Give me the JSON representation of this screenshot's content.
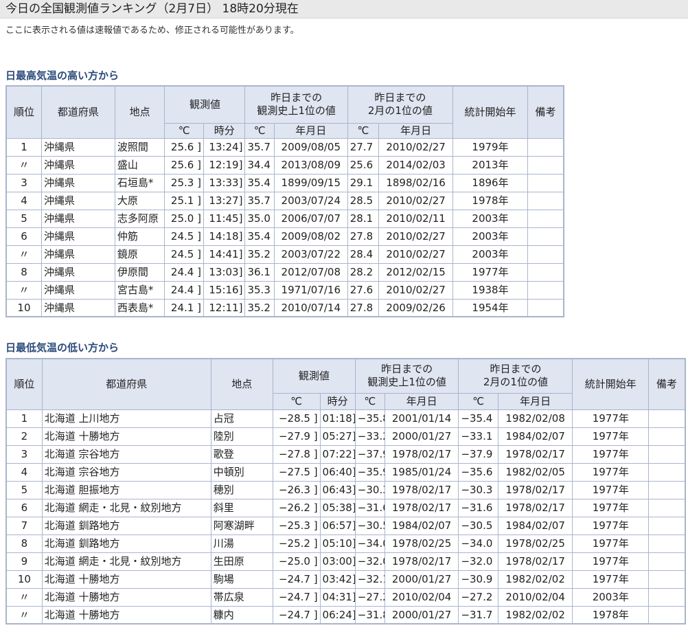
{
  "page": {
    "title": "今日の全国観測値ランキング（2月7日） 18時20分現在",
    "notice": "ここに表示される値は速報値であるため、修正される可能性があります。"
  },
  "headers": {
    "rank": "順位",
    "prefecture": "都道府県",
    "station": "地点",
    "observed": "観測値",
    "record_all": "昨日までの 観測史上1位の値",
    "record_month": "昨日までの 2月の1位の値",
    "start_year": "統計開始年",
    "remarks": "備考",
    "deg": "℃",
    "time": "時分",
    "date": "年月日"
  },
  "high": {
    "title": "日最高気温の高い方から",
    "rows": [
      {
        "rank": "1",
        "pref": "沖縄県",
        "station": "波照間",
        "val": "25.6 ]",
        "time": "13:24]",
        "rec_val": "35.7",
        "rec_date": "2009/08/05",
        "mon_val": "27.7",
        "mon_date": "2010/02/27",
        "start": "1979年",
        "note": ""
      },
      {
        "rank": "〃",
        "pref": "沖縄県",
        "station": "盛山",
        "val": "25.6 ]",
        "time": "12:19]",
        "rec_val": "34.4",
        "rec_date": "2013/08/09",
        "mon_val": "25.6",
        "mon_date": "2014/02/03",
        "start": "2013年",
        "note": ""
      },
      {
        "rank": "3",
        "pref": "沖縄県",
        "station": "石垣島*",
        "val": "25.3 ]",
        "time": "13:33]",
        "rec_val": "35.4",
        "rec_date": "1899/09/15",
        "mon_val": "29.1",
        "mon_date": "1898/02/16",
        "start": "1896年",
        "note": ""
      },
      {
        "rank": "4",
        "pref": "沖縄県",
        "station": "大原",
        "val": "25.1 ]",
        "time": "13:27]",
        "rec_val": "35.7",
        "rec_date": "2003/07/24",
        "mon_val": "28.5",
        "mon_date": "2010/02/27",
        "start": "1978年",
        "note": ""
      },
      {
        "rank": "5",
        "pref": "沖縄県",
        "station": "志多阿原",
        "val": "25.0 ]",
        "time": "11:45]",
        "rec_val": "35.0",
        "rec_date": "2006/07/07",
        "mon_val": "28.1",
        "mon_date": "2010/02/11",
        "start": "2003年",
        "note": ""
      },
      {
        "rank": "6",
        "pref": "沖縄県",
        "station": "仲筋",
        "val": "24.5 ]",
        "time": "14:18]",
        "rec_val": "35.4",
        "rec_date": "2009/08/02",
        "mon_val": "27.8",
        "mon_date": "2010/02/27",
        "start": "2003年",
        "note": ""
      },
      {
        "rank": "〃",
        "pref": "沖縄県",
        "station": "鏡原",
        "val": "24.5 ]",
        "time": "14:41]",
        "rec_val": "35.2",
        "rec_date": "2003/07/22",
        "mon_val": "28.4",
        "mon_date": "2010/02/27",
        "start": "2003年",
        "note": ""
      },
      {
        "rank": "8",
        "pref": "沖縄県",
        "station": "伊原間",
        "val": "24.4 ]",
        "time": "13:03]",
        "rec_val": "36.1",
        "rec_date": "2012/07/08",
        "mon_val": "28.2",
        "mon_date": "2012/02/15",
        "start": "1977年",
        "note": ""
      },
      {
        "rank": "〃",
        "pref": "沖縄県",
        "station": "宮古島*",
        "val": "24.4 ]",
        "time": "15:16]",
        "rec_val": "35.3",
        "rec_date": "1971/07/16",
        "mon_val": "27.6",
        "mon_date": "2010/02/27",
        "start": "1938年",
        "note": ""
      },
      {
        "rank": "10",
        "pref": "沖縄県",
        "station": "西表島*",
        "val": "24.1 ]",
        "time": "12:11]",
        "rec_val": "35.2",
        "rec_date": "2010/07/14",
        "mon_val": "27.8",
        "mon_date": "2009/02/26",
        "start": "1954年",
        "note": ""
      }
    ]
  },
  "low": {
    "title": "日最低気温の低い方から",
    "rows": [
      {
        "rank": "1",
        "pref": "北海道 上川地方",
        "station": "占冠",
        "val": "−28.5 ]",
        "time": "01:18]",
        "rec_val": "−35.8",
        "rec_date": "2001/01/14",
        "mon_val": "−35.4",
        "mon_date": "1982/02/08",
        "start": "1977年",
        "note": ""
      },
      {
        "rank": "2",
        "pref": "北海道 十勝地方",
        "station": "陸別",
        "val": "−27.9 ]",
        "time": "05:27]",
        "rec_val": "−33.2",
        "rec_date": "2000/01/27",
        "mon_val": "−33.1",
        "mon_date": "1984/02/07",
        "start": "1977年",
        "note": ""
      },
      {
        "rank": "3",
        "pref": "北海道 宗谷地方",
        "station": "歌登",
        "val": "−27.8 ]",
        "time": "07:22]",
        "rec_val": "−37.9",
        "rec_date": "1978/02/17",
        "mon_val": "−37.9",
        "mon_date": "1978/02/17",
        "start": "1977年",
        "note": ""
      },
      {
        "rank": "4",
        "pref": "北海道 宗谷地方",
        "station": "中頓別",
        "val": "−27.5 ]",
        "time": "06:40]",
        "rec_val": "−35.9",
        "rec_date": "1985/01/24",
        "mon_val": "−35.6",
        "mon_date": "1982/02/05",
        "start": "1977年",
        "note": ""
      },
      {
        "rank": "5",
        "pref": "北海道 胆振地方",
        "station": "穂別",
        "val": "−26.3 ]",
        "time": "06:43]",
        "rec_val": "−30.3",
        "rec_date": "1978/02/17",
        "mon_val": "−30.3",
        "mon_date": "1978/02/17",
        "start": "1977年",
        "note": ""
      },
      {
        "rank": "6",
        "pref": "北海道 網走・北見・紋別地方",
        "station": "斜里",
        "val": "−26.2 ]",
        "time": "05:38]",
        "rec_val": "−31.6",
        "rec_date": "1978/02/17",
        "mon_val": "−31.6",
        "mon_date": "1978/02/17",
        "start": "1977年",
        "note": ""
      },
      {
        "rank": "7",
        "pref": "北海道 釧路地方",
        "station": "阿寒湖畔",
        "val": "−25.3 ]",
        "time": "06:57]",
        "rec_val": "−30.5",
        "rec_date": "1984/02/07",
        "mon_val": "−30.5",
        "mon_date": "1984/02/07",
        "start": "1977年",
        "note": ""
      },
      {
        "rank": "8",
        "pref": "北海道 釧路地方",
        "station": "川湯",
        "val": "−25.2 ]",
        "time": "05:10]",
        "rec_val": "−34.0",
        "rec_date": "1978/02/25",
        "mon_val": "−34.0",
        "mon_date": "1978/02/25",
        "start": "1977年",
        "note": ""
      },
      {
        "rank": "9",
        "pref": "北海道 網走・北見・紋別地方",
        "station": "生田原",
        "val": "−25.0 ]",
        "time": "03:00]",
        "rec_val": "−32.0",
        "rec_date": "1978/02/17",
        "mon_val": "−32.0",
        "mon_date": "1978/02/17",
        "start": "1977年",
        "note": ""
      },
      {
        "rank": "10",
        "pref": "北海道 十勝地方",
        "station": "駒場",
        "val": "−24.7 ]",
        "time": "03:42]",
        "rec_val": "−32.1",
        "rec_date": "2000/01/27",
        "mon_val": "−30.9",
        "mon_date": "1982/02/02",
        "start": "1977年",
        "note": ""
      },
      {
        "rank": "〃",
        "pref": "北海道 十勝地方",
        "station": "帯広泉",
        "val": "−24.7 ]",
        "time": "04:31]",
        "rec_val": "−27.2",
        "rec_date": "2010/02/04",
        "mon_val": "−27.2",
        "mon_date": "2010/02/04",
        "start": "2003年",
        "note": ""
      },
      {
        "rank": "〃",
        "pref": "北海道 十勝地方",
        "station": "糠内",
        "val": "−24.7 ]",
        "time": "06:24]",
        "rec_val": "−31.8",
        "rec_date": "2000/01/27",
        "mon_val": "−31.7",
        "mon_date": "1982/02/02",
        "start": "1978年",
        "note": ""
      }
    ]
  }
}
